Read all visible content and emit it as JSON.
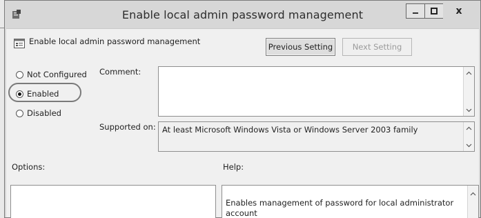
{
  "window": {
    "title": "Enable local admin password management",
    "close_glyph": "x"
  },
  "header": {
    "setting_name": "Enable local admin password management",
    "previous_setting_label": "Previous Setting",
    "next_setting_label": "Next Setting"
  },
  "state": {
    "options": [
      {
        "label": "Not Configured",
        "selected": false
      },
      {
        "label": "Enabled",
        "selected": true
      },
      {
        "label": "Disabled",
        "selected": false
      }
    ]
  },
  "fields": {
    "comment_label": "Comment:",
    "comment_value": "",
    "supported_on_label": "Supported on:",
    "supported_on_value": "At least Microsoft Windows Vista or Windows Server 2003 family"
  },
  "sections": {
    "options_label": "Options:",
    "help_label": "Help:",
    "help_text": "Enables management of password for local administrator account"
  },
  "icons": {
    "app": "policy-app-icon",
    "setting": "policy-setting-icon",
    "minimize": "minimize-icon",
    "maximize": "maximize-icon",
    "close": "close-icon",
    "scroll_up": "chevron-up-icon",
    "scroll_down": "chevron-down-icon"
  }
}
